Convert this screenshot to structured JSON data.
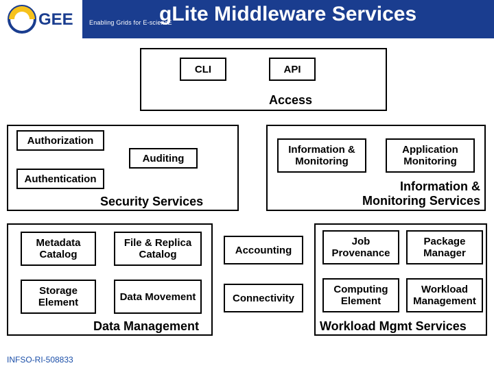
{
  "header": {
    "tagline": "Enabling Grids for E-sciencE",
    "title": "gLite Middleware Services"
  },
  "access": {
    "cli": "CLI",
    "api": "API",
    "label": "Access"
  },
  "security": {
    "authorization": "Authorization",
    "auditing": "Auditing",
    "authentication": "Authentication",
    "label": "Security Services"
  },
  "info_monitoring": {
    "info_mon": "Information & Monitoring",
    "app_mon": "Application Monitoring",
    "label": "Information & Monitoring Services"
  },
  "data_management": {
    "metadata_catalog": "Metadata Catalog",
    "file_replica_catalog": "File & Replica Catalog",
    "storage_element": "Storage Element",
    "data_movement": "Data Movement",
    "label": "Data Management"
  },
  "midcol": {
    "accounting": "Accounting",
    "connectivity": "Connectivity"
  },
  "workload": {
    "job_provenance": "Job Provenance",
    "package_manager": "Package Manager",
    "computing_element": "Computing Element",
    "workload_management": "Workload Management",
    "label": "Workload Mgmt Services"
  },
  "footer": "INFSO-RI-508833"
}
